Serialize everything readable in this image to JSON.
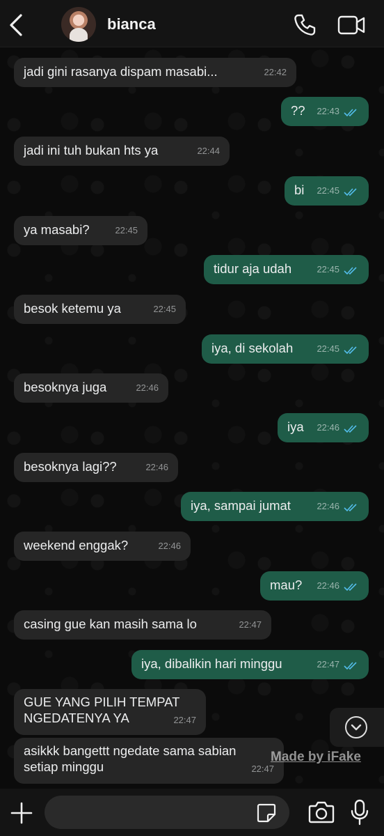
{
  "header": {
    "contact_name": "bianca",
    "back_icon": "chevron-left-icon",
    "call_icon": "phone-icon",
    "video_icon": "video-camera-icon"
  },
  "messages": [
    {
      "dir": "in",
      "text": "jadi gini rasanya dispam masabi...",
      "time": "22:42"
    },
    {
      "dir": "out",
      "text": "??",
      "time": "22:43",
      "status": "read"
    },
    {
      "dir": "in",
      "text": "jadi ini tuh bukan hts ya",
      "time": "22:44"
    },
    {
      "dir": "out",
      "text": "bi",
      "time": "22:45",
      "status": "read"
    },
    {
      "dir": "in",
      "text": "ya masabi?",
      "time": "22:45"
    },
    {
      "dir": "out",
      "text": "tidur aja udah",
      "time": "22:45",
      "status": "read"
    },
    {
      "dir": "in",
      "text": "besok ketemu ya",
      "time": "22:45"
    },
    {
      "dir": "out",
      "text": "iya, di sekolah",
      "time": "22:45",
      "status": "read"
    },
    {
      "dir": "in",
      "text": "besoknya juga",
      "time": "22:46"
    },
    {
      "dir": "out",
      "text": "iya",
      "time": "22:46",
      "status": "read"
    },
    {
      "dir": "in",
      "text": "besoknya lagi??",
      "time": "22:46"
    },
    {
      "dir": "out",
      "text": "iya, sampai jumat",
      "time": "22:46",
      "status": "read"
    },
    {
      "dir": "in",
      "text": "weekend enggak?",
      "time": "22:46"
    },
    {
      "dir": "out",
      "text": "mau?",
      "time": "22:46",
      "status": "read"
    },
    {
      "dir": "in",
      "text": "casing gue kan masih sama lo",
      "time": "22:47"
    },
    {
      "dir": "out",
      "text": "iya, dibalikin hari minggu",
      "time": "22:47",
      "status": "read"
    },
    {
      "dir": "in",
      "lines": [
        "GUE YANG PILIH TEMPAT",
        "NGEDATENYA YA"
      ],
      "time": "22:47"
    },
    {
      "dir": "in",
      "lines": [
        "asikkk bangettt ngedate sama sabian",
        "setiap minggu"
      ],
      "time": "22:47"
    }
  ],
  "watermark": "Made by iFake",
  "scroll_down_icon": "chevron-down-circle-icon",
  "composer": {
    "placeholder": "",
    "plus_icon": "plus-icon",
    "sticker_icon": "sticker-icon",
    "camera_icon": "camera-icon",
    "mic_icon": "microphone-icon"
  },
  "colors": {
    "incoming_bubble": "#262626",
    "outgoing_bubble": "#1f5c48",
    "read_ticks": "#53bdeb",
    "background": "#0b0b0b"
  }
}
